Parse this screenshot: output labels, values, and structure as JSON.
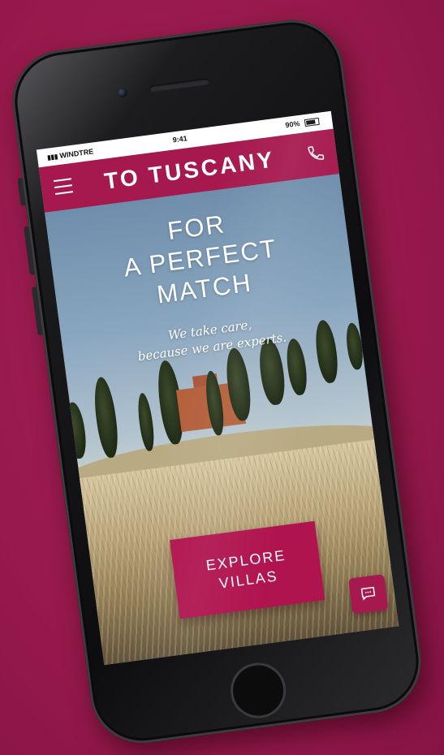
{
  "status_bar": {
    "carrier": "WINDTRE",
    "time": "9:41",
    "battery": "90%"
  },
  "header": {
    "logo_text": "TO TUSCANY",
    "brand_color": "#a6194f"
  },
  "hero": {
    "headline_lines": [
      "FOR",
      "A PERFECT",
      "MATCH"
    ],
    "tagline_lines": [
      "We take care,",
      "because we are experts."
    ]
  },
  "cta": {
    "lines": [
      "EXPLORE",
      "VILLAS"
    ]
  },
  "icons": {
    "menu": "hamburger-icon",
    "phone": "phone-icon",
    "chat": "chat-bubble-icon"
  },
  "colors": {
    "background": "#9b1b4e",
    "accent": "#b0144f"
  }
}
